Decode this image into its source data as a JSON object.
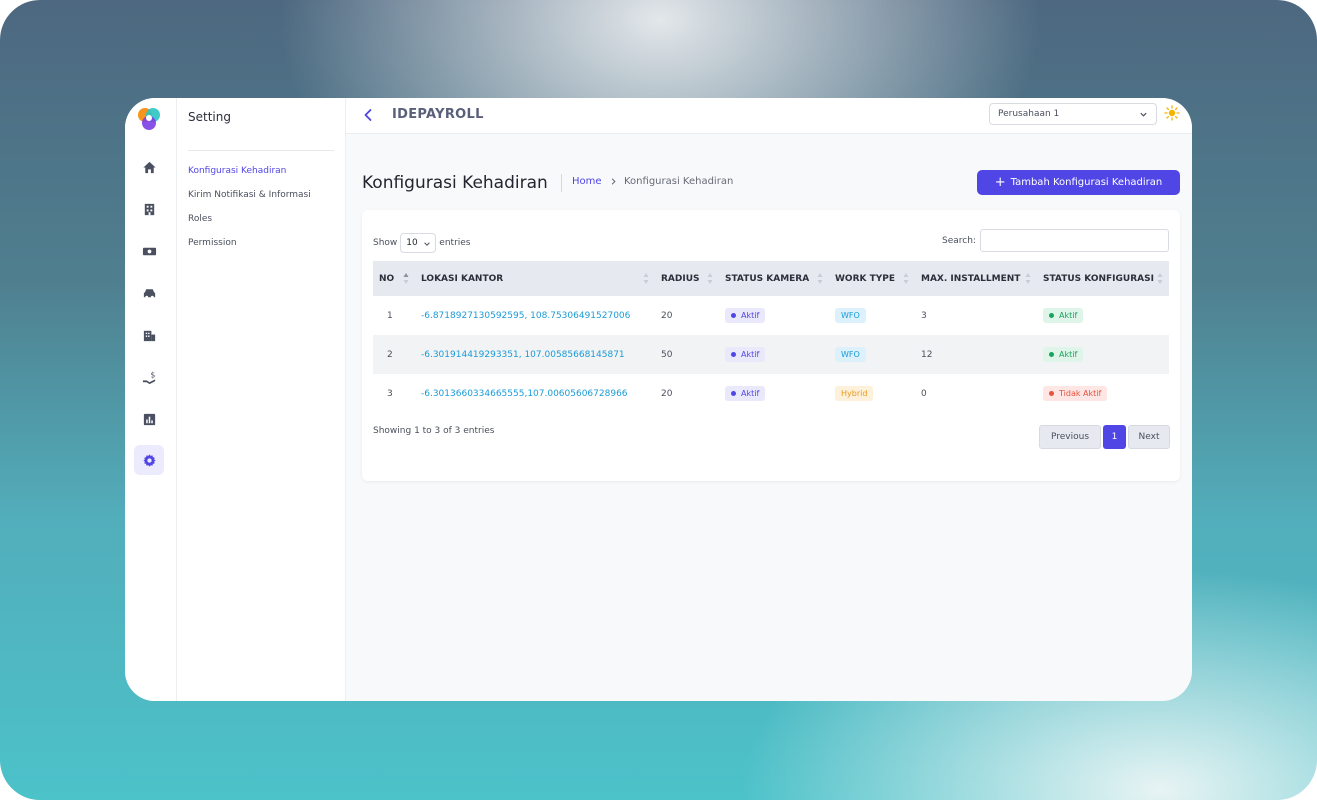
{
  "app": {
    "brand": "IDEPAYROLL"
  },
  "settings_sidebar": {
    "title": "Setting",
    "items": [
      {
        "label": "Konfigurasi Kehadiran",
        "active": true
      },
      {
        "label": "Kirim Notifikasi & Informasi",
        "active": false
      },
      {
        "label": "Roles",
        "active": false
      },
      {
        "label": "Permission",
        "active": false
      }
    ]
  },
  "rail_icons": [
    "home-icon",
    "building-icon",
    "money-icon",
    "car-icon",
    "office-icon",
    "salary-icon",
    "report-icon",
    "gear-icon"
  ],
  "header": {
    "company": "Perusahaan 1"
  },
  "page": {
    "title": "Konfigurasi Kehadiran",
    "breadcrumb_home": "Home",
    "breadcrumb_current": "Konfigurasi Kehadiran",
    "add_button": "Tambah Konfigurasi Kehadiran"
  },
  "table_controls": {
    "show_label": "Show",
    "entries_value": "10",
    "entries_label": "entries",
    "search_label": "Search:"
  },
  "table": {
    "columns": [
      "NO",
      "LOKASI KANTOR",
      "RADIUS",
      "STATUS KAMERA",
      "WORK TYPE",
      "MAX. INSTALLMENT",
      "STATUS KONFIGURASI"
    ],
    "rows": [
      {
        "no": "1",
        "lokasi": "-6.8718927130592595, 108.75306491527006",
        "radius": "20",
        "kamera": "Aktif",
        "work_type": "WFO",
        "max_installment": "3",
        "status": "Aktif"
      },
      {
        "no": "2",
        "lokasi": "-6.301914419293351, 107.00585668145871",
        "radius": "50",
        "kamera": "Aktif",
        "work_type": "WFO",
        "max_installment": "12",
        "status": "Aktif"
      },
      {
        "no": "3",
        "lokasi": "-6.3013660334665555,107.00605606728966",
        "radius": "20",
        "kamera": "Aktif",
        "work_type": "Hybrid",
        "max_installment": "0",
        "status": "Tidak Aktif"
      }
    ]
  },
  "pagination": {
    "info": "Showing 1 to 3 of 3 entries",
    "previous": "Previous",
    "current": "1",
    "next": "Next"
  },
  "colors": {
    "accent": "#5046e5",
    "link": "#1a9bd7",
    "success": "#1aa35c",
    "danger": "#e5533f",
    "warning": "#e89a1c"
  }
}
